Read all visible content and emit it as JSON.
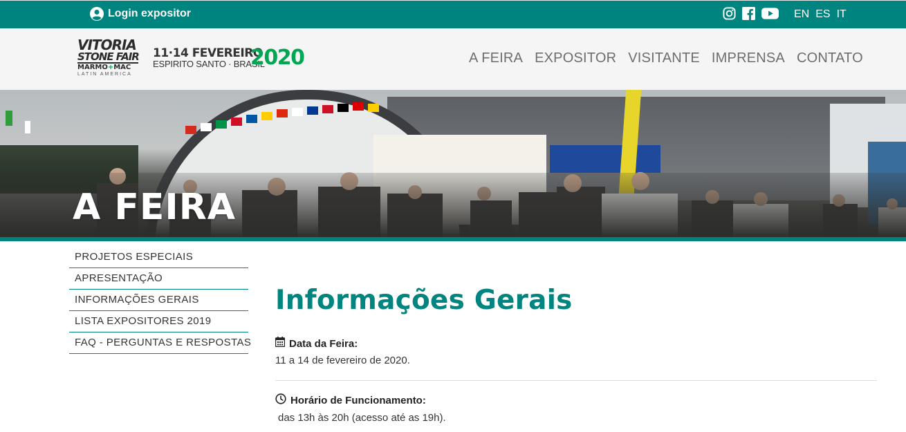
{
  "topbar": {
    "login_label": "Login expositor",
    "social_icons": [
      "instagram-icon",
      "facebook-icon",
      "youtube-icon"
    ],
    "languages": [
      "EN",
      "ES",
      "IT"
    ],
    "background_color": "#00847f"
  },
  "header": {
    "logo": {
      "line1": "VITORIA",
      "line2": "STONE FAIR",
      "line3_a": "MARMO",
      "line3_plus": "+",
      "line3_b": "MAC",
      "line4": "LATIN AMERICA"
    },
    "dates_line1": "11·14 FEVEREIRO",
    "dates_line2": "ESPIRITO SANTO · BRASIL",
    "year": "2020",
    "nav": [
      "A FEIRA",
      "EXPOSITOR",
      "VISITANTE",
      "IMPRENSA",
      "CONTATO"
    ]
  },
  "hero": {
    "title": "A FEIRA"
  },
  "sidemenu": {
    "items": [
      "PROJETOS ESPECIAIS",
      "APRESENTAÇÃO",
      "INFORMAÇÕES GERAIS",
      "LISTA EXPOSITORES 2019",
      "FAQ - PERGUNTAS E RESPOSTAS"
    ]
  },
  "main": {
    "title": "Informações Gerais",
    "sections": [
      {
        "icon": "calendar-icon",
        "label": "Data da Feira:",
        "value": "11 a 14 de fevereiro de 2020."
      },
      {
        "icon": "clock-icon",
        "label": "Horário de Funcionamento:",
        "value": "das 13h às 20h (acesso até as 19h)."
      }
    ]
  },
  "colors": {
    "accent": "#00847f",
    "brand_green": "#00a651"
  }
}
